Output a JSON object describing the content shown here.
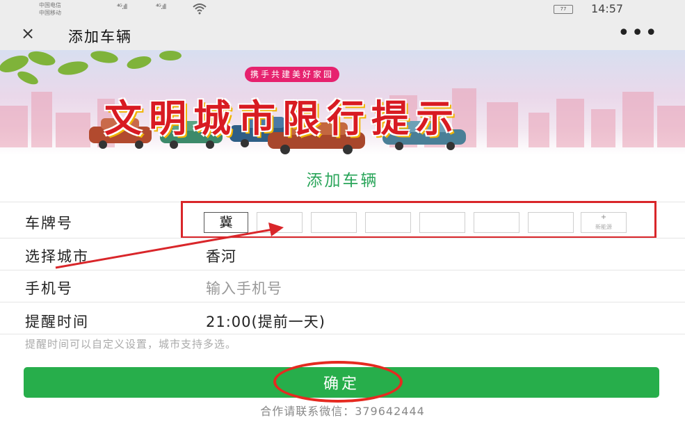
{
  "status_bar": {
    "carrier_1": "中国电信",
    "carrier_2": "中国移动",
    "signal_1": "⁴ᴳ.ıll",
    "signal_2": "⁴ᴳ.ıll",
    "battery": "77",
    "time": "14:57"
  },
  "titlebar": {
    "close_icon": "×",
    "title": "添加车辆",
    "more_icon": "•••"
  },
  "banner": {
    "subtitle": "携手共建美好家园",
    "title": "文明城市限行提示"
  },
  "section_heading": "添加车辆",
  "form": {
    "plate": {
      "label": "车牌号",
      "province": "冀",
      "new_energy_plus": "+",
      "new_energy_text": "新能源"
    },
    "city": {
      "label": "选择城市",
      "value": "香河"
    },
    "phone": {
      "label": "手机号",
      "placeholder": "输入手机号"
    },
    "remind": {
      "label": "提醒时间",
      "value": "21:00(提前一天)"
    },
    "hint": "提醒时间可以自定义设置，城市支持多选。"
  },
  "confirm_label": "确定",
  "contact": "合作请联系微信：379642444",
  "colors": {
    "accent_green": "#27ae4b",
    "heading_green": "#2aa55a",
    "annotation_red": "#d9262a"
  }
}
